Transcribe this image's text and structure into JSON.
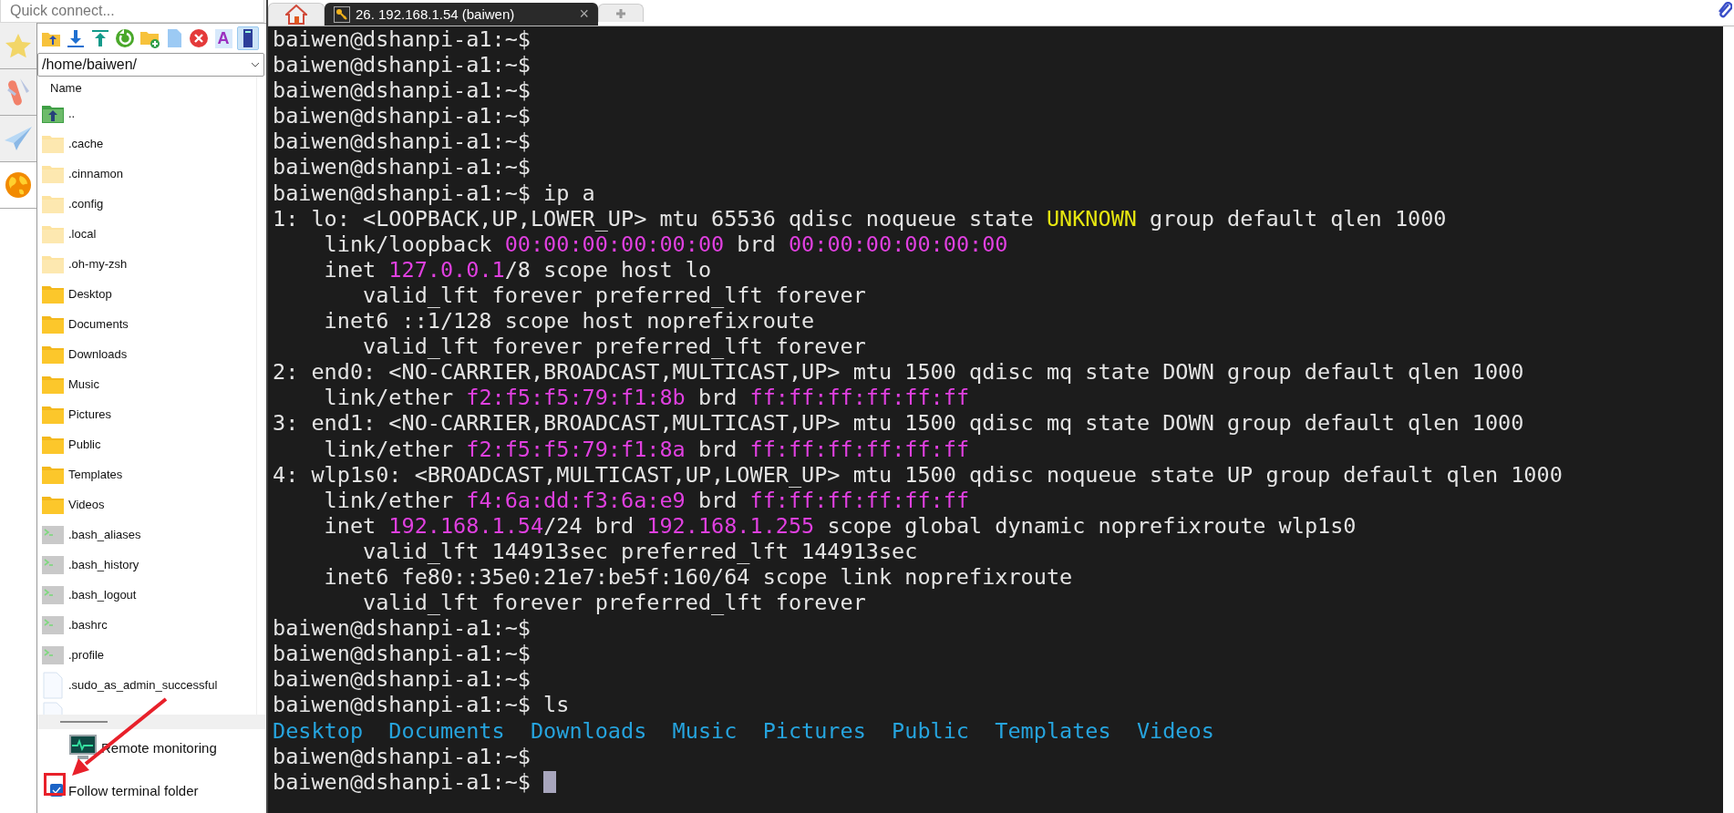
{
  "quick_connect": {
    "placeholder": "Quick connect..."
  },
  "tabs": [
    {
      "kind": "home",
      "selected": false
    },
    {
      "kind": "session",
      "label": "26. 192.168.1.54 (baiwen)",
      "close": "×",
      "selected": true
    },
    {
      "kind": "new",
      "selected": false
    }
  ],
  "file_browser": {
    "toolbar": [
      {
        "kind": "parent",
        "selected": false
      },
      {
        "kind": "download",
        "selected": false
      },
      {
        "kind": "upload",
        "selected": false
      },
      {
        "kind": "refresh",
        "selected": false
      },
      {
        "kind": "new_folder",
        "selected": false
      },
      {
        "kind": "new_file",
        "selected": false
      },
      {
        "kind": "delete",
        "selected": false
      },
      {
        "kind": "text",
        "glyph": "A",
        "selected": false
      },
      {
        "kind": "terminal_panel",
        "selected": true
      }
    ],
    "path": "/home/baiwen/",
    "columns": [
      "Name"
    ],
    "files": [
      {
        "kind": "parent",
        "name": ".."
      },
      {
        "kind": "hidden_folder",
        "name": ".cache"
      },
      {
        "kind": "hidden_folder",
        "name": ".cinnamon"
      },
      {
        "kind": "hidden_folder",
        "name": ".config"
      },
      {
        "kind": "hidden_folder",
        "name": ".local"
      },
      {
        "kind": "hidden_folder",
        "name": ".oh-my-zsh"
      },
      {
        "kind": "folder",
        "name": "Desktop"
      },
      {
        "kind": "folder",
        "name": "Documents"
      },
      {
        "kind": "folder",
        "name": "Downloads"
      },
      {
        "kind": "folder",
        "name": "Music"
      },
      {
        "kind": "folder",
        "name": "Pictures"
      },
      {
        "kind": "folder",
        "name": "Public"
      },
      {
        "kind": "folder",
        "name": "Templates"
      },
      {
        "kind": "folder",
        "name": "Videos"
      },
      {
        "kind": "script",
        "name": ".bash_aliases"
      },
      {
        "kind": "script",
        "name": ".bash_history"
      },
      {
        "kind": "script",
        "name": ".bash_logout"
      },
      {
        "kind": "script",
        "name": ".bashrc"
      },
      {
        "kind": "script",
        "name": ".profile"
      },
      {
        "kind": "file",
        "name": ".sudo_as_admin_successful"
      },
      {
        "kind": "file"
      }
    ]
  },
  "remote_monitoring": {
    "label": "Remote monitoring"
  },
  "follow_terminal_folder": {
    "label": "Follow terminal folder",
    "checked": true
  },
  "terminal": {
    "lines": [
      [
        {
          "text": "baiwen@dshanpi-a1:~$"
        }
      ],
      [
        {
          "text": "baiwen@dshanpi-a1:~$"
        }
      ],
      [
        {
          "text": "baiwen@dshanpi-a1:~$"
        }
      ],
      [
        {
          "text": "baiwen@dshanpi-a1:~$"
        }
      ],
      [
        {
          "text": "baiwen@dshanpi-a1:~$"
        }
      ],
      [
        {
          "text": "baiwen@dshanpi-a1:~$"
        }
      ],
      [
        {
          "text": "baiwen@dshanpi-a1:~$ ip a"
        }
      ],
      [
        {
          "text": "1: lo: <LOOPBACK,UP,LOWER_UP> mtu 65536 qdisc noqueue state "
        },
        {
          "text": "UNKNOWN",
          "color": "#e6e610"
        },
        {
          "text": " group default qlen 1000"
        }
      ],
      [
        {
          "text": "    link/loopback "
        },
        {
          "text": "00:00:00:00:00:00",
          "color": "#e040e0"
        },
        {
          "text": " brd "
        },
        {
          "text": "00:00:00:00:00:00",
          "color": "#e040e0"
        }
      ],
      [
        {
          "text": "    inet "
        },
        {
          "text": "127.0.0.1",
          "color": "#e040e0"
        },
        {
          "text": "/8 scope host lo"
        }
      ],
      [
        {
          "text": "       valid_lft forever preferred_lft forever"
        }
      ],
      [
        {
          "text": "    inet6 ::1/128 scope host noprefixroute"
        }
      ],
      [
        {
          "text": "       valid_lft forever preferred_lft forever"
        }
      ],
      [
        {
          "text": "2: end0: <NO-CARRIER,BROADCAST,MULTICAST,UP> mtu 1500 qdisc mq state DOWN group default qlen 1000"
        }
      ],
      [
        {
          "text": "    link/ether "
        },
        {
          "text": "f2:f5:f5:79:f1:8b",
          "color": "#e040e0"
        },
        {
          "text": " brd "
        },
        {
          "text": "ff:ff:ff:ff:ff:ff",
          "color": "#e040e0"
        }
      ],
      [
        {
          "text": "3: end1: <NO-CARRIER,BROADCAST,MULTICAST,UP> mtu 1500 qdisc mq state DOWN group default qlen 1000"
        }
      ],
      [
        {
          "text": "    link/ether "
        },
        {
          "text": "f2:f5:f5:79:f1:8a",
          "color": "#e040e0"
        },
        {
          "text": " brd "
        },
        {
          "text": "ff:ff:ff:ff:ff:ff",
          "color": "#e040e0"
        }
      ],
      [
        {
          "text": "4: wlp1s0: <BROADCAST,MULTICAST,UP,LOWER_UP> mtu 1500 qdisc noqueue state UP group default qlen 1000"
        }
      ],
      [
        {
          "text": "    link/ether "
        },
        {
          "text": "f4:6a:dd:f3:6a:e9",
          "color": "#e040e0"
        },
        {
          "text": " brd "
        },
        {
          "text": "ff:ff:ff:ff:ff:ff",
          "color": "#e040e0"
        }
      ],
      [
        {
          "text": "    inet "
        },
        {
          "text": "192.168.1.54",
          "color": "#e040e0"
        },
        {
          "text": "/24 brd "
        },
        {
          "text": "192.168.1.255",
          "color": "#e040e0"
        },
        {
          "text": " scope global dynamic noprefixroute wlp1s0"
        }
      ],
      [
        {
          "text": "       valid_lft 144913sec preferred_lft 144913sec"
        }
      ],
      [
        {
          "text": "    inet6 fe80::35e0:21e7:be5f:160/64 scope link noprefixroute"
        }
      ],
      [
        {
          "text": "       valid_lft forever preferred_lft forever"
        }
      ],
      [
        {
          "text": "baiwen@dshanpi-a1:~$"
        }
      ],
      [
        {
          "text": "baiwen@dshanpi-a1:~$"
        }
      ],
      [
        {
          "text": "baiwen@dshanpi-a1:~$"
        }
      ],
      [
        {
          "text": "baiwen@dshanpi-a1:~$ ls"
        }
      ],
      [
        {
          "text": "Desktop  Documents  Downloads  Music  Pictures  Public  Templates  Videos",
          "color": "#26a4de"
        }
      ],
      [
        {
          "text": "baiwen@dshanpi-a1:~$"
        }
      ],
      [
        {
          "text": "baiwen@dshanpi-a1:~$ "
        }
      ]
    ]
  }
}
